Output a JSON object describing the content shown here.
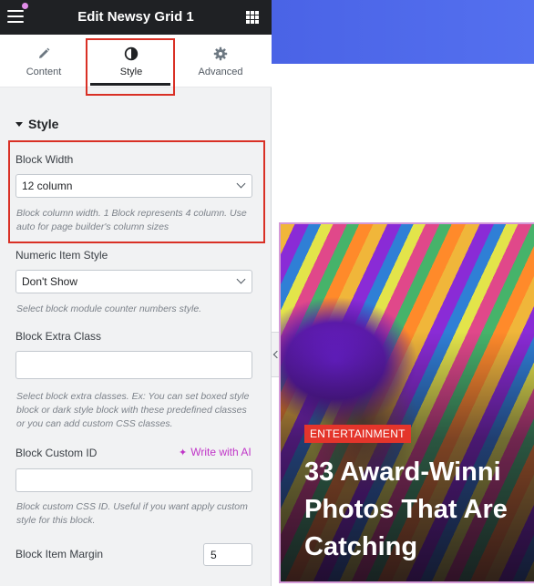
{
  "panel": {
    "title": "Edit Newsy Grid 1"
  },
  "tabs": [
    {
      "label": "Content",
      "icon": "pencil-icon"
    },
    {
      "label": "Style",
      "icon": "contrast-icon"
    },
    {
      "label": "Advanced",
      "icon": "gear-icon"
    }
  ],
  "section": {
    "title": "Style"
  },
  "fields": {
    "block_width": {
      "label": "Block Width",
      "value": "12 column",
      "help": "Block column width. 1 Block represents 4 column. Use auto for page builder's column sizes"
    },
    "numeric_item_style": {
      "label": "Numeric Item Style",
      "value": "Don't Show",
      "help": "Select block module counter numbers style."
    },
    "block_extra_class": {
      "label": "Block Extra Class",
      "value": "",
      "help": "Select block extra classes. Ex: You can set boxed style block or dark style block with these predefined classes or you can add custom CSS classes."
    },
    "block_custom_id": {
      "label": "Block Custom ID",
      "ai_label": "Write with AI",
      "value": "",
      "help": "Block custom CSS ID. Useful if you want apply custom style for this block."
    },
    "block_item_margin": {
      "label": "Block Item Margin",
      "value": "5"
    }
  },
  "preview": {
    "category": "ENTERTAINMENT",
    "title": "33 Award-Winni\nPhotos That Are\nCatching"
  },
  "colors": {
    "topbar": "#1f2124",
    "highlight": "#d93025",
    "ai_accent": "#c036c8",
    "hero_blue": "#4a63e6",
    "category_red": "#e4352b"
  }
}
